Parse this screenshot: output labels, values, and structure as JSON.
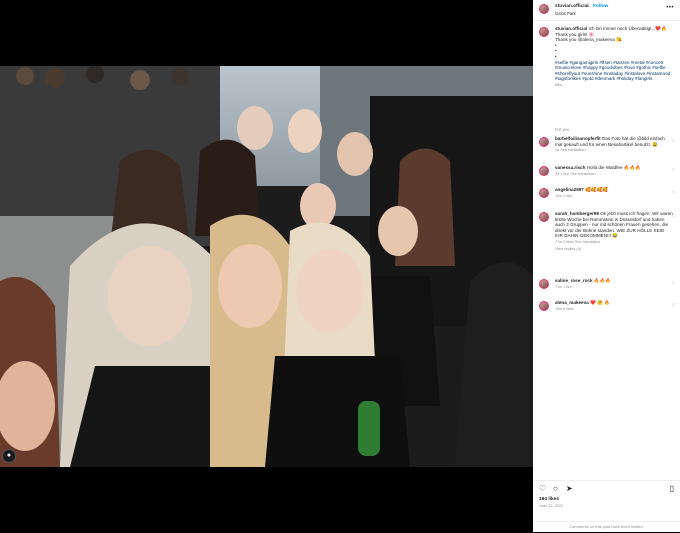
{
  "header": {
    "username": "stuvian.official",
    "separator": "•",
    "follow": "Follow",
    "location": "Gelos Park",
    "more": "•••"
  },
  "caption": {
    "username": "stuvian.official",
    "text": "Ich bin immer noch Überwältigt...❤️🔥",
    "line2": "Thank you girls! 🌸",
    "line3": "Thank you @alena_makeeva 😘",
    "dots": [
      "•",
      "•",
      "•"
    ],
    "hashtags": "#selfie #gangamigirls #ffsen #tanzen #metal #concert #musicinlove #happy #goodvibes #love #gothic #selfie #shoreflyout #sunshine #instaday #instalove #instamood #tagsforlikes #potd #denmark #holiday #fangirls",
    "time": "68w"
  },
  "for_you": "For you",
  "comments": [
    {
      "username": "barbelfoilisanopferfit",
      "text": "Das Foto hat die @bild einfach mal gekauft und für einen Besahartikel benutzt. 😅",
      "meta": "1d   See translation"
    },
    {
      "username": "vanessa.risch",
      "text": "Holla die Waldfee 🔥🔥🔥",
      "meta": "2d   1 like   See translation"
    },
    {
      "username": "angelina2697",
      "text": "🥰🥰🥰🥰",
      "meta": "19w   1 like"
    },
    {
      "username": "sarah_homberger98",
      "text": "Ok jetzt muss ich fragen: Wir waren letzte Woche bei Rammstein in Düsseldorf und haben auch 2 Gruppen - nur mit schönen Frauen gesehen, die direkt vor der Bühne standen. WIE ZUR HÖLLE SEID IHR DAHIN GEKOMMEN!!! 😂",
      "meta": "77w   3 likes   See translation",
      "replies": "View replies (4)"
    },
    {
      "username": "saline_rose_rock",
      "text": "🔥🔥🔥",
      "meta": "71w   1 like"
    },
    {
      "username": "alena_makeeva",
      "text": "❤️ 🤗 🔥",
      "meta": "78w   6 likes"
    }
  ],
  "actions": {
    "heart": "♡",
    "comment": "○",
    "share": "➤",
    "save": "▯"
  },
  "likes": "184 likes",
  "date": "June 22, 2022",
  "limited": "Comments on this post have been limited."
}
